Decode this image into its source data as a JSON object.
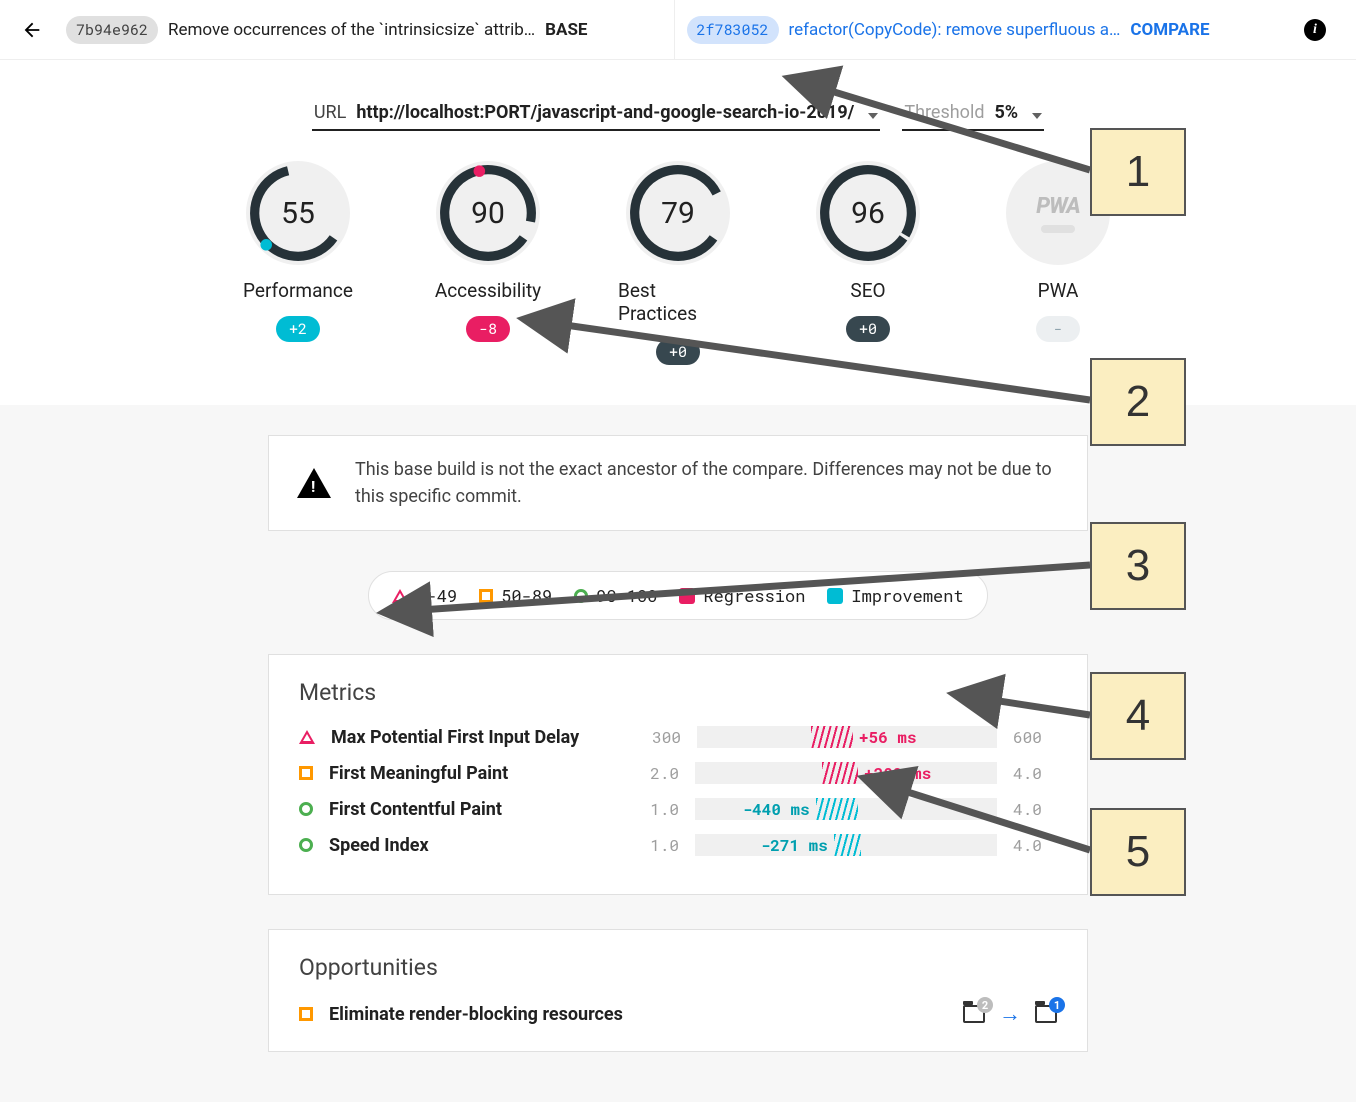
{
  "header": {
    "base": {
      "hash": "7b94e962",
      "msg": "Remove occurrences of the `intrinsicsize` attrib…",
      "role": "BASE"
    },
    "compare": {
      "hash": "2f783052",
      "msg": "refactor(CopyCode): remove superfluous a…",
      "role": "COMPARE"
    }
  },
  "url_row": {
    "url_label": "URL",
    "url_value": "http://localhost:PORT/javascript-and-google-search-io-2019/",
    "thresh_label": "Threshold",
    "thresh_value": "5%"
  },
  "gauges": [
    {
      "score": "55",
      "label": "Performance",
      "delta": "+2",
      "pill": "teal"
    },
    {
      "score": "90",
      "label": "Accessibility",
      "delta": "-8",
      "pill": "pink"
    },
    {
      "score": "79",
      "label": "Best Practices",
      "delta": "+0",
      "pill": "dark"
    },
    {
      "score": "96",
      "label": "SEO",
      "delta": "+0",
      "pill": "dark"
    },
    {
      "score": "",
      "label": "PWA",
      "delta": "-",
      "pill": "none",
      "pwa": true
    }
  ],
  "warning": "This base build is not the exact ancestor of the compare. Differences may not be due to this specific commit.",
  "legend": {
    "r1": "0-49",
    "r2": "50-89",
    "r3": "90-100",
    "reg": "Regression",
    "imp": "Improvement"
  },
  "metrics_title": "Metrics",
  "metrics": [
    {
      "shape": "tri",
      "name": "Max Potential First Input Delay",
      "min": "300",
      "max": "600",
      "delta": "+56 ms",
      "color": "pink",
      "hatch_l": 38,
      "hatch_w": 14,
      "label_side": "right"
    },
    {
      "shape": "sq",
      "name": "First Meaningful Paint",
      "min": "2.0",
      "max": "4.0",
      "delta": "+209 ms",
      "color": "pink",
      "hatch_l": 42,
      "hatch_w": 12,
      "label_side": "right"
    },
    {
      "shape": "cir",
      "name": "First Contentful Paint",
      "min": "1.0",
      "max": "4.0",
      "delta": "-440 ms",
      "color": "teal",
      "hatch_l": 40,
      "hatch_w": 14,
      "label_side": "left"
    },
    {
      "shape": "cir",
      "name": "Speed Index",
      "min": "1.0",
      "max": "4.0",
      "delta": "-271 ms",
      "color": "teal",
      "hatch_l": 46,
      "hatch_w": 9,
      "label_side": "left"
    }
  ],
  "opps_title": "Opportunities",
  "opps": [
    {
      "shape": "sq",
      "name": "Eliminate render-blocking resources",
      "badge_l": "2",
      "badge_r": "1"
    }
  ],
  "annotations": [
    "1",
    "2",
    "3",
    "4",
    "5"
  ]
}
